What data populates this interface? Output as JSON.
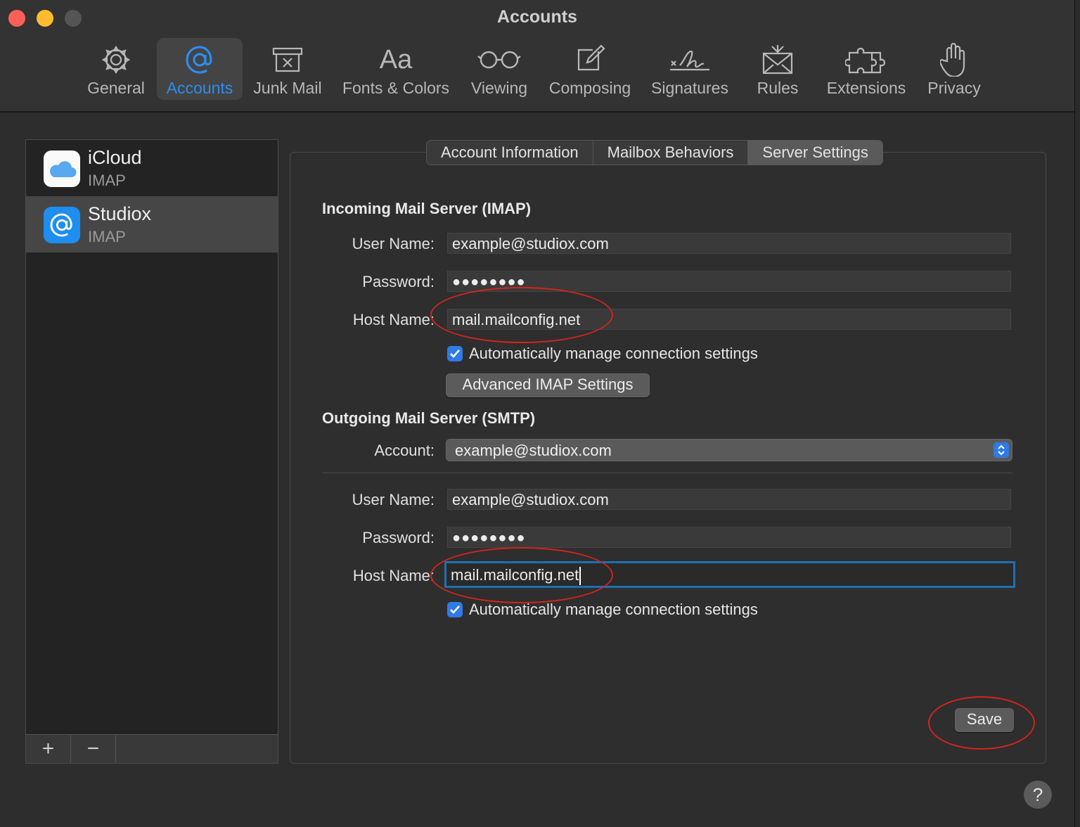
{
  "window": {
    "title": "Accounts"
  },
  "toolbar": {
    "items": [
      {
        "label": "General",
        "icon": "gear-icon"
      },
      {
        "label": "Accounts",
        "icon": "at-sign-icon",
        "active": true
      },
      {
        "label": "Junk Mail",
        "icon": "junk-tray-icon"
      },
      {
        "label": "Fonts & Colors",
        "icon": "font-aa-icon"
      },
      {
        "label": "Viewing",
        "icon": "glasses-icon"
      },
      {
        "label": "Composing",
        "icon": "compose-pencil-icon"
      },
      {
        "label": "Signatures",
        "icon": "signature-icon"
      },
      {
        "label": "Rules",
        "icon": "envelope-rules-icon"
      },
      {
        "label": "Extensions",
        "icon": "puzzle-piece-icon"
      },
      {
        "label": "Privacy",
        "icon": "hand-icon"
      }
    ]
  },
  "accounts": [
    {
      "name": "iCloud",
      "type": "IMAP",
      "icon": "icloud-icon"
    },
    {
      "name": "Studiox",
      "type": "IMAP",
      "icon": "at-sign-icon",
      "selected": true
    }
  ],
  "list_controls": {
    "add": "+",
    "remove": "−"
  },
  "tabs": [
    {
      "label": "Account Information"
    },
    {
      "label": "Mailbox Behaviors"
    },
    {
      "label": "Server Settings",
      "active": true
    }
  ],
  "incoming": {
    "title": "Incoming Mail Server (IMAP)",
    "user_label": "User Name:",
    "user_value": "example@studiox.com",
    "password_label": "Password:",
    "password_value": "●●●●●●●●",
    "host_label": "Host Name:",
    "host_value": "mail.mailconfig.net",
    "auto_manage": "Automatically manage connection settings",
    "advanced_button": "Advanced IMAP Settings"
  },
  "outgoing": {
    "title": "Outgoing Mail Server (SMTP)",
    "account_label": "Account:",
    "account_value": "example@studiox.com",
    "user_label": "User Name:",
    "user_value": "example@studiox.com",
    "password_label": "Password:",
    "password_value": "●●●●●●●●",
    "host_label": "Host Name:",
    "host_value": "mail.mailconfig.net",
    "auto_manage": "Automatically manage connection settings"
  },
  "actions": {
    "save": "Save",
    "help": "?"
  },
  "colors": {
    "accent": "#2d8cf0",
    "annotation": "#d0261c",
    "checkbox": "#2f7be6"
  }
}
